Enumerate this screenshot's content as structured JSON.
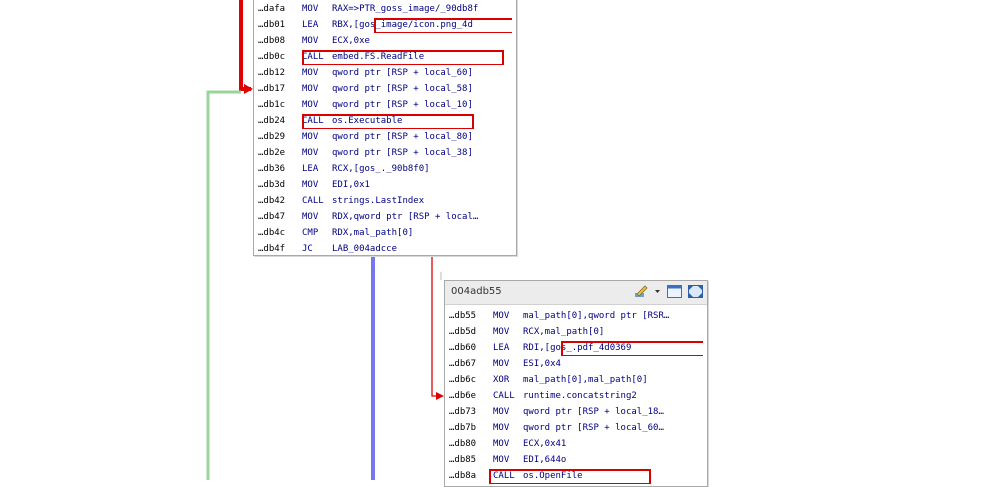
{
  "blocks": [
    {
      "id": "block1",
      "lines": [
        {
          "addr": "…dafa",
          "mnemonic": "MOV",
          "operands": "RAX=>PTR_goss_image/_90db8f"
        },
        {
          "addr": "…db01",
          "mnemonic": "LEA",
          "operands": "RBX,[gos_image/icon.png_4d"
        },
        {
          "addr": "…db08",
          "mnemonic": "MOV",
          "operands": "ECX,0xe"
        },
        {
          "addr": "…db0c",
          "mnemonic": "CALL",
          "operands": "embed.FS.ReadFile"
        },
        {
          "addr": "…db12",
          "mnemonic": "MOV",
          "operands": "qword ptr [RSP + local_60]"
        },
        {
          "addr": "…db17",
          "mnemonic": "MOV",
          "operands": "qword ptr [RSP + local_58]"
        },
        {
          "addr": "…db1c",
          "mnemonic": "MOV",
          "operands": "qword ptr [RSP + local_10]"
        },
        {
          "addr": "…db24",
          "mnemonic": "CALL",
          "operands": "os.Executable"
        },
        {
          "addr": "…db29",
          "mnemonic": "MOV",
          "operands": "qword ptr [RSP + local_80]"
        },
        {
          "addr": "…db2e",
          "mnemonic": "MOV",
          "operands": "qword ptr [RSP + local_38]"
        },
        {
          "addr": "…db36",
          "mnemonic": "LEA",
          "operands": "RCX,[gos_._90b8f0]"
        },
        {
          "addr": "…db3d",
          "mnemonic": "MOV",
          "operands": "EDI,0x1"
        },
        {
          "addr": "…db42",
          "mnemonic": "CALL",
          "operands": "strings.LastIndex"
        },
        {
          "addr": "…db47",
          "mnemonic": "MOV",
          "operands": "RDX,qword ptr [RSP + local…"
        },
        {
          "addr": "…db4c",
          "mnemonic": "CMP",
          "operands": "RDX,mal_path[0]"
        },
        {
          "addr": "…db4f",
          "mnemonic": "JC",
          "operands": "LAB_004adcce"
        }
      ]
    },
    {
      "id": "block2",
      "title": "004adb55",
      "lines": [
        {
          "addr": "…db55",
          "mnemonic": "MOV",
          "operands": "mal_path[0],qword ptr [RSR…"
        },
        {
          "addr": "…db5d",
          "mnemonic": "MOV",
          "operands": "RCX,mal_path[0]"
        },
        {
          "addr": "…db60",
          "mnemonic": "LEA",
          "operands": "RDI,[gos_.pdf_4d0369"
        },
        {
          "addr": "…db67",
          "mnemonic": "MOV",
          "operands": "ESI,0x4"
        },
        {
          "addr": "…db6c",
          "mnemonic": "XOR",
          "operands": "mal_path[0],mal_path[0]"
        },
        {
          "addr": "…db6e",
          "mnemonic": "CALL",
          "operands": "runtime.concatstring2"
        },
        {
          "addr": "…db73",
          "mnemonic": "MOV",
          "operands": "qword ptr [RSP + local_18…"
        },
        {
          "addr": "…db7b",
          "mnemonic": "MOV",
          "operands": "qword ptr [RSP + local_60…"
        },
        {
          "addr": "…db80",
          "mnemonic": "MOV",
          "operands": "ECX,0x41"
        },
        {
          "addr": "…db85",
          "mnemonic": "MOV",
          "operands": "EDI,644o"
        },
        {
          "addr": "…db8a",
          "mnemonic": "CALL",
          "operands": "os.OpenFile"
        }
      ]
    }
  ],
  "toolbar": {
    "icons": [
      "edit-icon",
      "dropdown-arrow-icon",
      "window-icon",
      "fullscreen-icon"
    ]
  },
  "colors": {
    "highlight": "#d90000",
    "flow_true": "#00aa00",
    "flow_false": "#e00000",
    "flow_uncond": "#4040ff"
  }
}
